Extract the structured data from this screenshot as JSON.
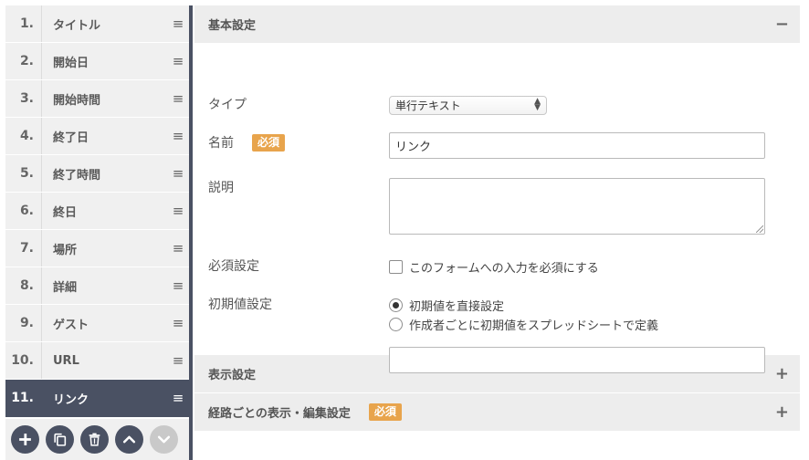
{
  "fields": [
    {
      "num": "1.",
      "name": "タイトル",
      "active": false
    },
    {
      "num": "2.",
      "name": "開始日",
      "active": false
    },
    {
      "num": "3.",
      "name": "開始時間",
      "active": false
    },
    {
      "num": "4.",
      "name": "終了日",
      "active": false
    },
    {
      "num": "5.",
      "name": "終了時間",
      "active": false
    },
    {
      "num": "6.",
      "name": "終日",
      "active": false
    },
    {
      "num": "7.",
      "name": "場所",
      "active": false
    },
    {
      "num": "8.",
      "name": "詳細",
      "active": false
    },
    {
      "num": "9.",
      "name": "ゲスト",
      "active": false
    },
    {
      "num": "10.",
      "name": "URL",
      "active": false
    },
    {
      "num": "11.",
      "name": "リンク",
      "active": true
    }
  ],
  "handle_glyph": "≡",
  "tools": [
    "add-icon",
    "copy-icon",
    "trash-icon",
    "chevron-up-icon",
    "chevron-down-icon"
  ],
  "basic": {
    "title": "基本設定",
    "toggle": "−",
    "type_label": "タイプ",
    "type_value": "単行テキスト",
    "name_label": "名前",
    "required_badge": "必須",
    "name_value": "リンク",
    "desc_label": "説明",
    "desc_value": "",
    "required_label": "必須設定",
    "required_check": "このフォームへの入力を必須にする",
    "default_label": "初期値設定",
    "default_opt1": "初期値を直接設定",
    "default_opt2": "作成者ごとに初期値をスプレッドシートで定義",
    "default_value": ""
  },
  "display": {
    "title": "表示設定",
    "toggle": "+"
  },
  "route": {
    "title": "経路ごとの表示・編集設定",
    "badge": "必須",
    "toggle": "+"
  },
  "colors": {
    "active": "#4a5163",
    "badge": "#e8a44c",
    "header": "#ededed"
  }
}
